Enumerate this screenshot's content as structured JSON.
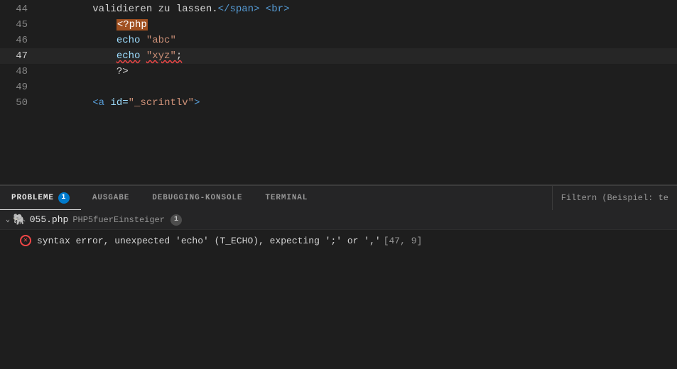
{
  "editor": {
    "lines": [
      {
        "number": "44",
        "tokens": "validieren_zu_lassen",
        "raw": true
      },
      {
        "number": "45",
        "type": "php-open"
      },
      {
        "number": "46",
        "type": "echo-abc"
      },
      {
        "number": "47",
        "type": "echo-xyz",
        "active": true
      },
      {
        "number": "48",
        "type": "php-close"
      },
      {
        "number": "49",
        "type": "empty"
      },
      {
        "number": "50",
        "type": "a-tag"
      }
    ]
  },
  "tabs": {
    "items": [
      {
        "id": "probleme",
        "label": "PROBLEME",
        "active": true,
        "badge": "1"
      },
      {
        "id": "ausgabe",
        "label": "AUSGABE",
        "active": false
      },
      {
        "id": "debugging",
        "label": "DEBUGGING-KONSOLE",
        "active": false
      },
      {
        "id": "terminal",
        "label": "TERMINAL",
        "active": false
      }
    ],
    "filter_placeholder": "Filtern (Beispiel: te"
  },
  "file": {
    "name": "055.php",
    "folder": "PHP5fuerEinsteiger",
    "error_count": "1"
  },
  "error": {
    "message": "syntax error, unexpected 'echo' (T_ECHO), expecting ';' or ','",
    "location": "[47, 9]"
  }
}
